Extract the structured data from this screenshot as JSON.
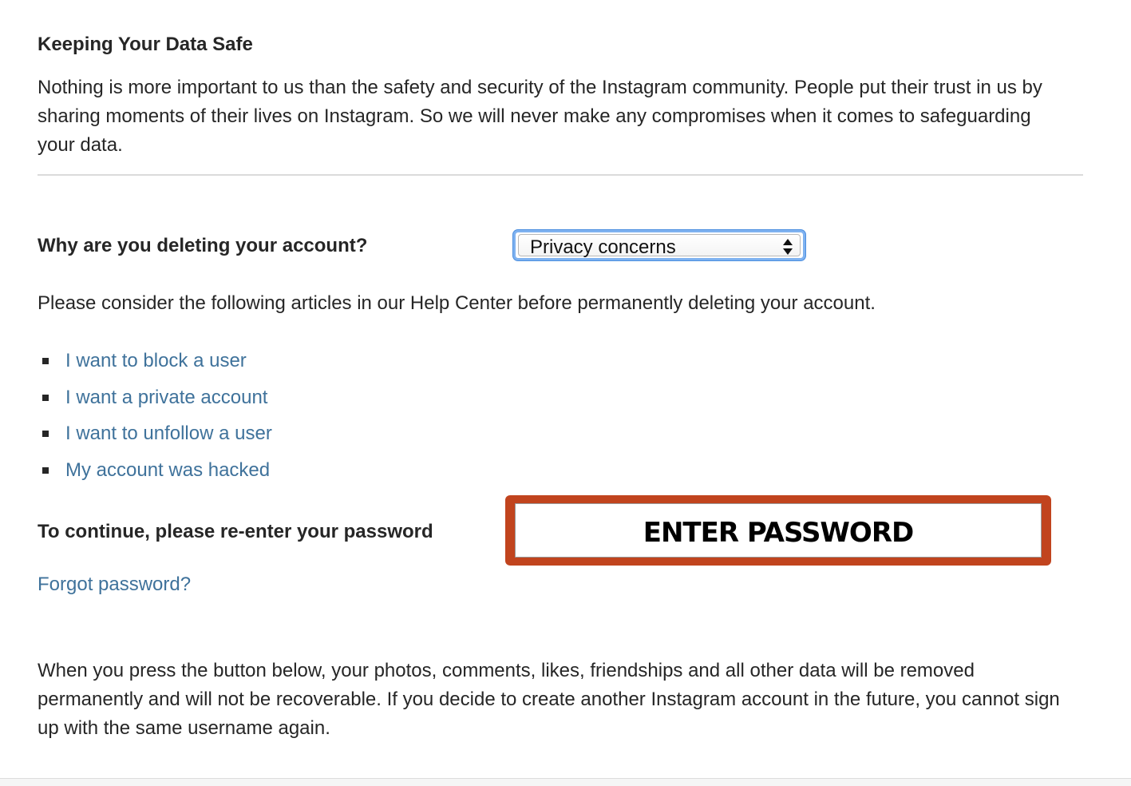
{
  "section": {
    "title": "Keeping Your Data Safe",
    "intro": "Nothing is more important to us than the safety and security of the Instagram community. People put their trust in us by sharing moments of their lives on Instagram. So we will never make any compromises when it comes to safeguarding your data."
  },
  "reason": {
    "label": "Why are you deleting your account?",
    "selected": "Privacy concerns",
    "focus_color": "#7fb2f0"
  },
  "help": {
    "text": "Please consider the following articles in our Help Center before permanently deleting your account.",
    "articles": [
      {
        "label": "I want to block a user"
      },
      {
        "label": "I want a private account"
      },
      {
        "label": "I want to unfollow a user"
      },
      {
        "label": "My account was hacked"
      }
    ],
    "link_color": "#3f729b"
  },
  "password": {
    "label": "To continue, please re-enter your password",
    "overlay_text": "ENTER PASSWORD",
    "highlight_color": "#c1441e",
    "forgot_label": "Forgot password?"
  },
  "warning": {
    "text": "When you press the button below, your photos, comments, likes, friendships and all other data will be removed permanently and will not be recoverable. If you decide to create another Instagram account in the future, you cannot sign up with the same username again."
  }
}
